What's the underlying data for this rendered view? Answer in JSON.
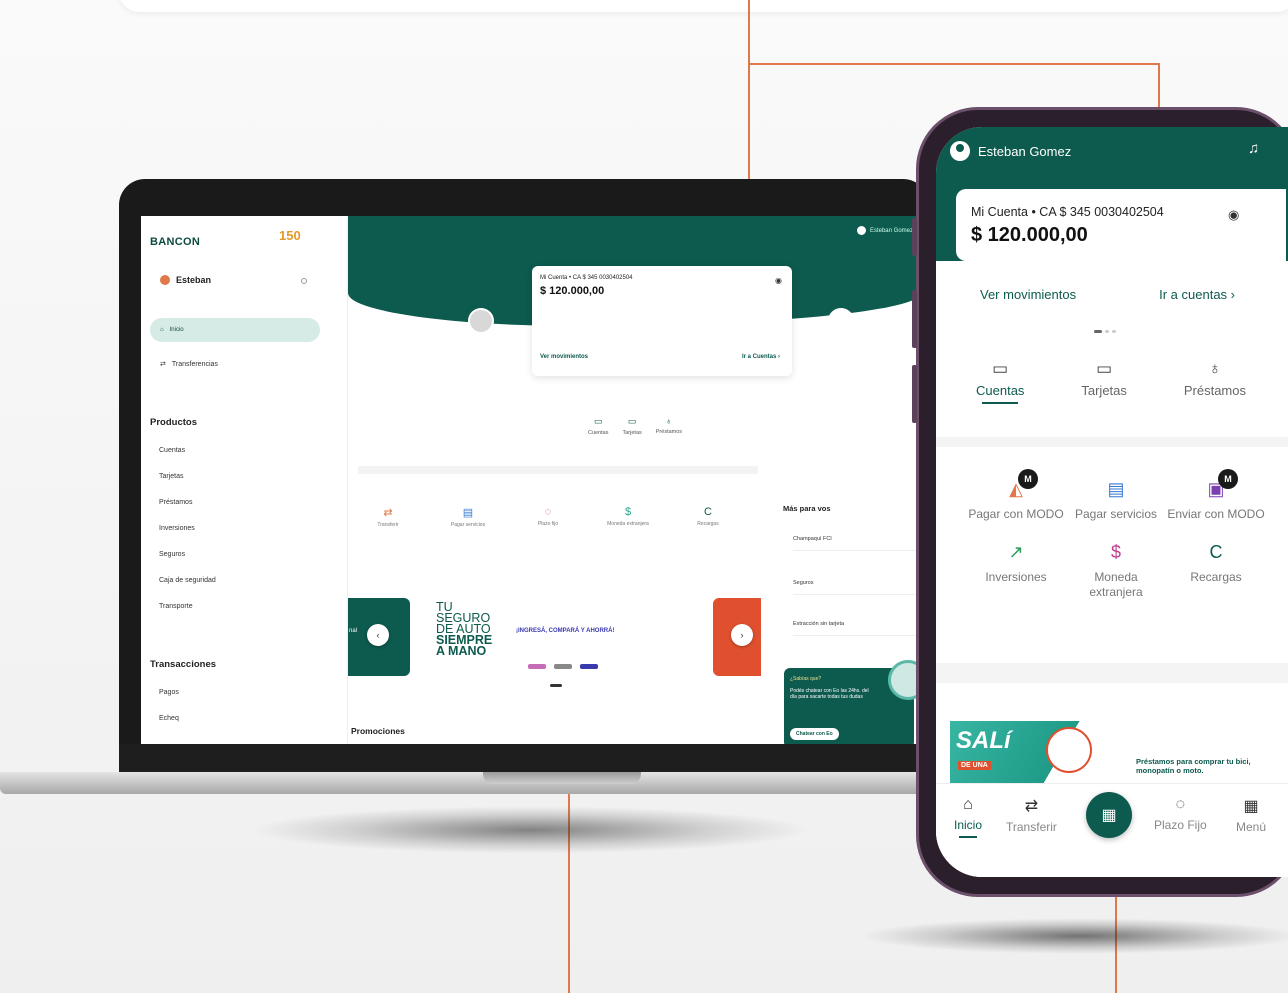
{
  "laptop": {
    "brand": "BANCON",
    "badge": "150",
    "user": "Esteban",
    "nav_active": "Inicio",
    "nav_transfer": "Transferencias",
    "products_title": "Productos",
    "products": [
      "Cuentas",
      "Tarjetas",
      "Préstamos",
      "Inversiones",
      "Seguros",
      "Caja de seguridad",
      "Transporte"
    ],
    "transactions_title": "Transacciones",
    "transactions": [
      "Pagos",
      "Echeq"
    ],
    "top_user": "Esteban Gomez",
    "account_label": "Mi Cuenta • CA $ 345 0030402504",
    "balance": "$ 120.000,00",
    "link_movements": "Ver movimientos",
    "link_accounts": "Ir a Cuentas  ›",
    "tabs": [
      "Cuentas",
      "Tarjetas",
      "Préstamos"
    ],
    "actions": [
      "Transferir",
      "Pagar servicios",
      "Plazo fijo",
      "Moneda extranjera",
      "Recargas"
    ],
    "more_title": "Más para vos",
    "more_items": [
      "Champaquí FCI",
      "Seguros",
      "Extracción sin tarjeta"
    ],
    "promo_left": "nal",
    "promo_headline_1": "TU",
    "promo_headline_2": "SEGURO",
    "promo_headline_3": "DE AUTO",
    "promo_headline_4": "SIEMPRE",
    "promo_headline_5": "A MANO",
    "promo_cta": "¡INGRESÁ, COMPARÁ Y AHORRÁ!",
    "promos_title": "Promociones",
    "chat_q": "¿Sabías que?",
    "chat_text": "Podés chatear con Eo las 24hs. del día para sacarte todas tus dudas",
    "chat_button": "Chatear con Eo",
    "nav_prev": "‹",
    "nav_next": "›"
  },
  "phone": {
    "user": "Esteban Gomez",
    "account_label": "Mi Cuenta • CA $ 345 0030402504",
    "balance": "$ 120.000,00",
    "link_movements": "Ver movimientos",
    "link_accounts": "Ir a cuentas  ›",
    "tabs": [
      "Cuentas",
      "Tarjetas",
      "Préstamos"
    ],
    "actions": [
      {
        "label": "Pagar con MODO",
        "badge": "M"
      },
      {
        "label": "Pagar servicios",
        "badge": ""
      },
      {
        "label": "Enviar con MODO",
        "badge": "M"
      },
      {
        "label": "Inversiones",
        "badge": ""
      },
      {
        "label": "Moneda extranjera",
        "badge": ""
      },
      {
        "label": "Recargas",
        "badge": ""
      }
    ],
    "promo_title": "SALí",
    "promo_tag": "DE UNA",
    "promo_text": "Préstamos para comprar tu bici, monopatín o moto.",
    "bottom_nav": [
      "Inicio",
      "Transferir",
      "Plazo Fijo",
      "Menú"
    ]
  },
  "colors": {
    "brand_green": "#0d5a4e",
    "accent_orange": "#e07849",
    "light_green": "#d6ebe6"
  }
}
